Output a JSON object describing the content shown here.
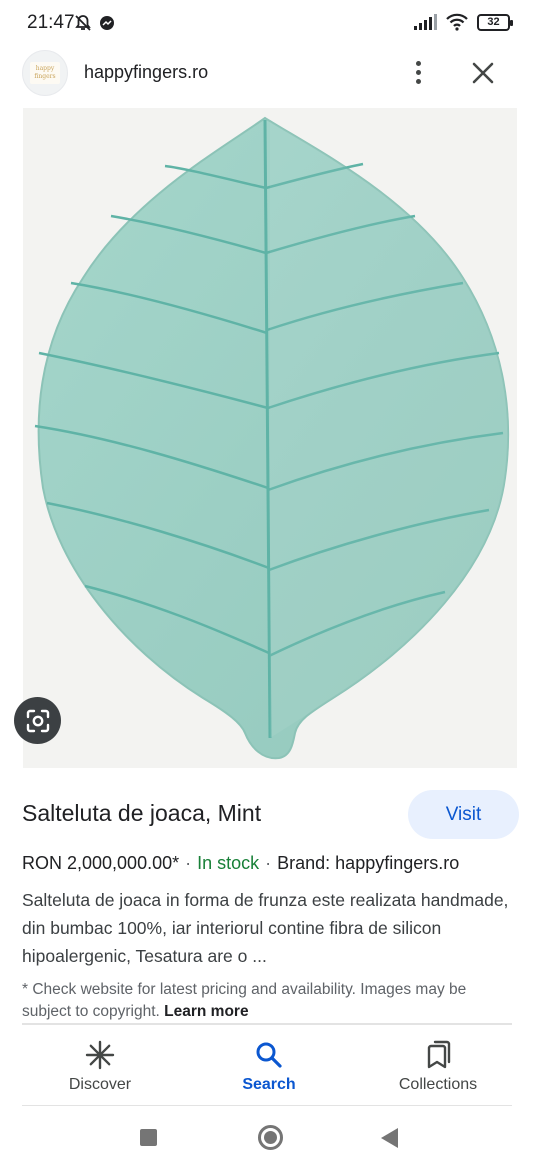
{
  "status_bar": {
    "time": "21:47",
    "battery": "32",
    "icons_left": [
      "mute-icon",
      "messenger-icon"
    ],
    "icons_right": [
      "signal-icon",
      "wifi-icon",
      "battery-icon"
    ]
  },
  "header": {
    "site_name": "happyfingers.ro",
    "avatar_text": "happy fingers"
  },
  "image": {
    "subject": "leaf-shaped mint play mat",
    "colors": {
      "background": "#f3f3f1",
      "mat": "#9ccfc4",
      "seam": "#5fb3a6"
    }
  },
  "product": {
    "title": "Salteluta de joaca, Mint",
    "visit_label": "Visit",
    "price": "RON 2,000,000.00*",
    "stock": "In stock",
    "brand": "Brand: happyfingers.ro",
    "description": "Salteluta de joaca in forma de frunza este realizata handmade, din bumbac 100%, iar interiorul contine fibra de silicon hipoalergenic, Tesatura are o ...",
    "disclaimer": "* Check website for latest pricing and availability. Images may be subject to copyright.",
    "learn_more": "Learn more"
  },
  "bottom_nav": {
    "items": [
      {
        "label": "Discover",
        "icon": "asterisk-icon",
        "active": false
      },
      {
        "label": "Search",
        "icon": "search-icon",
        "active": true
      },
      {
        "label": "Collections",
        "icon": "bookmarks-icon",
        "active": false
      }
    ]
  },
  "colors": {
    "accent": "#0b57d0",
    "visit_bg": "#e8f0fe",
    "stock_green": "#188038"
  }
}
